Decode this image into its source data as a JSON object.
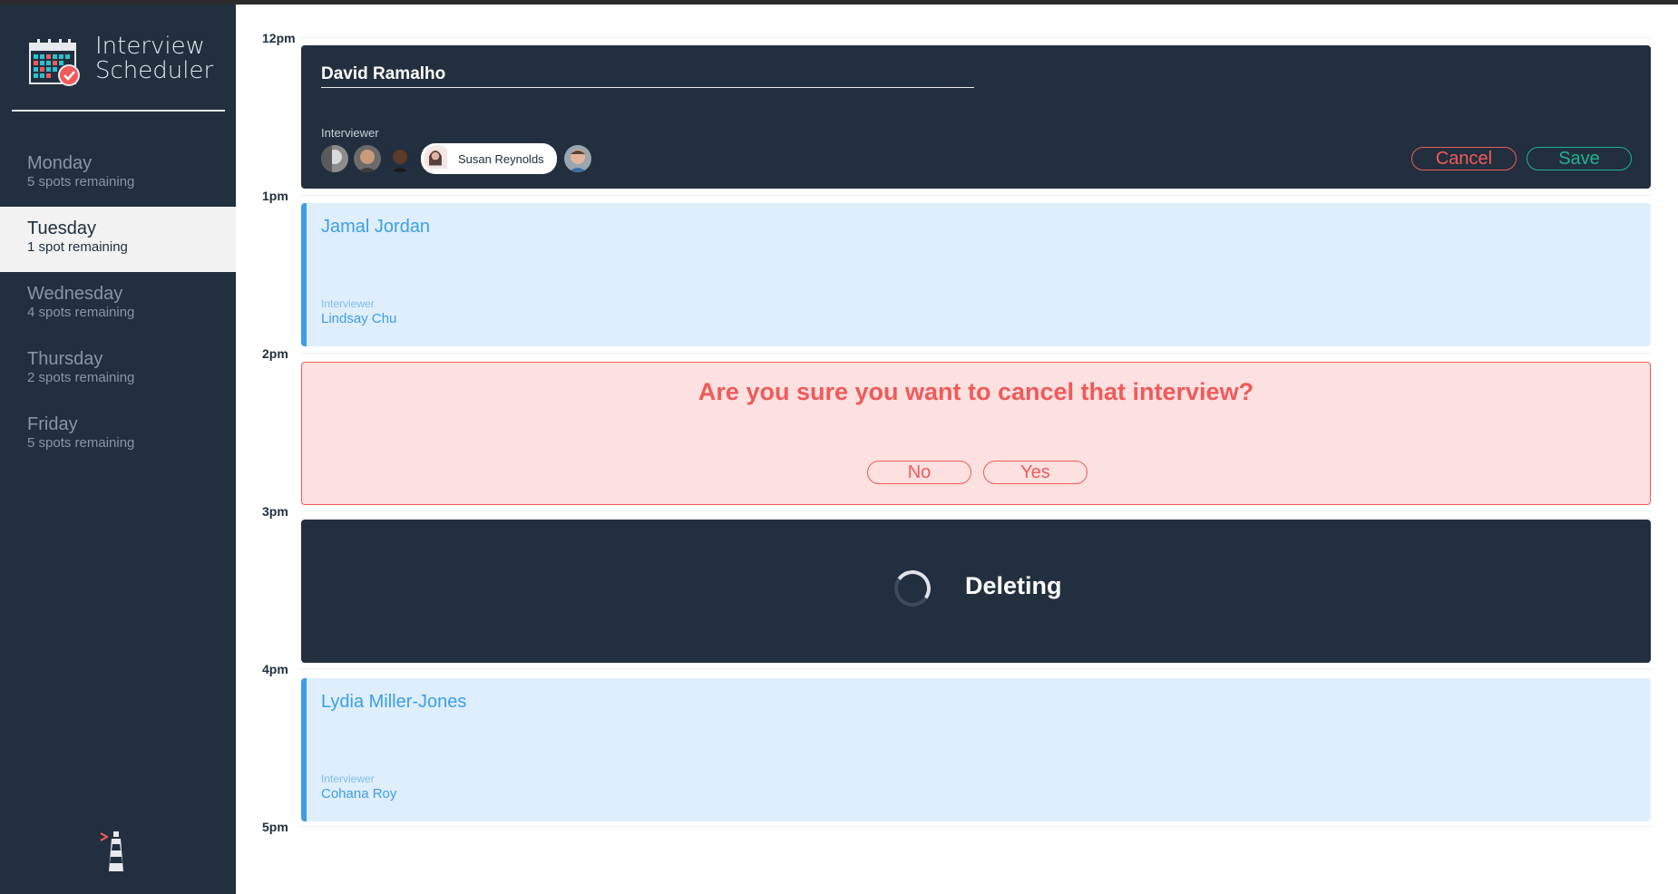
{
  "app": {
    "title_line1": "Interview",
    "title_line2": "Scheduler"
  },
  "days": [
    {
      "name": "Monday",
      "spots": "5 spots remaining",
      "selected": false
    },
    {
      "name": "Tuesday",
      "spots": "1 spot remaining",
      "selected": true
    },
    {
      "name": "Wednesday",
      "spots": "4 spots remaining",
      "selected": false
    },
    {
      "name": "Thursday",
      "spots": "2 spots remaining",
      "selected": false
    },
    {
      "name": "Friday",
      "spots": "5 spots remaining",
      "selected": false
    }
  ],
  "hours": [
    "12pm",
    "1pm",
    "2pm",
    "3pm",
    "4pm",
    "5pm"
  ],
  "form": {
    "student_value": "David Ramalho",
    "interviewer_label": "Interviewer",
    "selected_interviewer": "Susan Reynolds",
    "cancel_label": "Cancel",
    "save_label": "Save"
  },
  "appointment_1pm": {
    "student": "Jamal Jordan",
    "interviewer_label": "Interviewer",
    "interviewer": "Lindsay Chu"
  },
  "confirm": {
    "message": "Are you sure you want to cancel that interview?",
    "no_label": "No",
    "yes_label": "Yes"
  },
  "status": {
    "message": "Deleting"
  },
  "appointment_4pm": {
    "student": "Lydia Miller-Jones",
    "interviewer_label": "Interviewer",
    "interviewer": "Cohana Roy"
  },
  "colors": {
    "sidebar": "#222f3e",
    "show_bg": "#dfeefb",
    "show_accent": "#3b9ee8",
    "danger": "#f05a5a",
    "confirm_bg": "#fde0e0",
    "save": "#20b28e"
  },
  "icons": {
    "brand": "calendar-check-icon",
    "footer": "lighthouse-icon",
    "loading": "spinner-icon"
  }
}
